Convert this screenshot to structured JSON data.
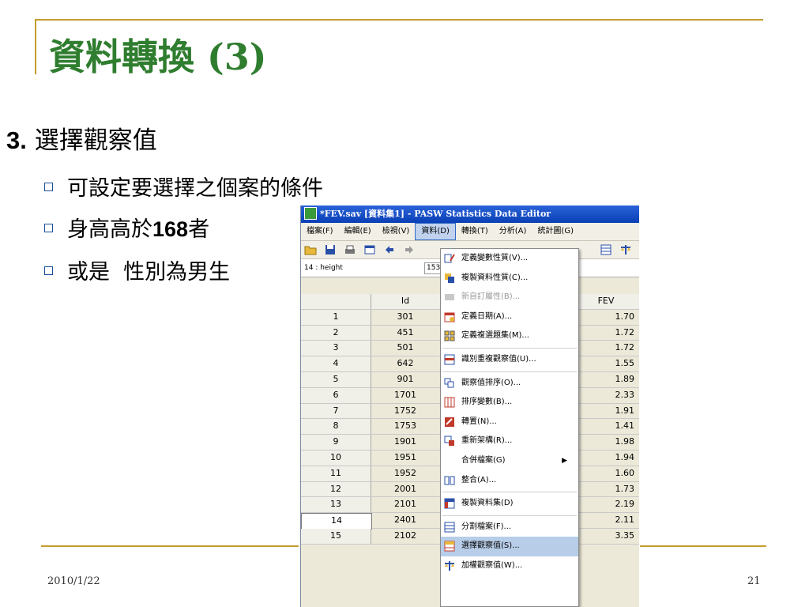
{
  "slide": {
    "title": "資料轉換 (3)",
    "heading_num": "3.",
    "heading_text": "選擇觀察值",
    "bullets": [
      "可設定要選擇之個案的條件",
      "身高高於",
      "168",
      "者",
      "或是  性別為男生"
    ],
    "footer_date": "2010/1/22",
    "page_number": "21"
  },
  "window": {
    "title": "*FEV.sav [資料集1] - PASW Statistics Data Editor",
    "menu": [
      "檔案(F)",
      "編輯(E)",
      "檢視(V)",
      "資料(D)",
      "轉換(T)",
      "分析(A)",
      "統計圖(G)"
    ],
    "active_menu": "資料(D)",
    "cell_ref": "14 : height",
    "cell_value": "153",
    "columns": {
      "id": "Id",
      "fev": "FEV"
    },
    "rows": [
      {
        "n": "1",
        "id": "301",
        "fev": "1.70"
      },
      {
        "n": "2",
        "id": "451",
        "fev": "1.72"
      },
      {
        "n": "3",
        "id": "501",
        "fev": "1.72"
      },
      {
        "n": "4",
        "id": "642",
        "fev": "1.55"
      },
      {
        "n": "5",
        "id": "901",
        "fev": "1.89"
      },
      {
        "n": "6",
        "id": "1701",
        "fev": "2.33"
      },
      {
        "n": "7",
        "id": "1752",
        "fev": "1.91"
      },
      {
        "n": "8",
        "id": "1753",
        "fev": "1.41"
      },
      {
        "n": "9",
        "id": "1901",
        "fev": "1.98"
      },
      {
        "n": "10",
        "id": "1951",
        "fev": "1.94"
      },
      {
        "n": "11",
        "id": "1952",
        "fev": "1.60"
      },
      {
        "n": "12",
        "id": "2001",
        "fev": "1.73"
      },
      {
        "n": "13",
        "id": "2101",
        "fev": "2.19"
      },
      {
        "n": "14",
        "id": "2401",
        "fev": "2.11"
      },
      {
        "n": "15",
        "id": "2102",
        "fev": "3.35"
      }
    ],
    "dropdown": {
      "items": [
        "定義變數性質(V)...",
        "複製資料性質(C)...",
        "新自訂屬性(B)...",
        "定義日期(A)...",
        "定義複選題集(M)...",
        "識別重複觀察值(U)...",
        "觀察值排序(O)...",
        "排序變數(B)...",
        "轉置(N)...",
        "重新架構(R)...",
        "合併檔案(G)",
        "整合(A)...",
        "複製資料集(D)",
        "分割檔案(F)...",
        "選擇觀察值(S)...",
        "加權觀察值(W)..."
      ],
      "highlighted": "選擇觀察值(S)..."
    }
  }
}
